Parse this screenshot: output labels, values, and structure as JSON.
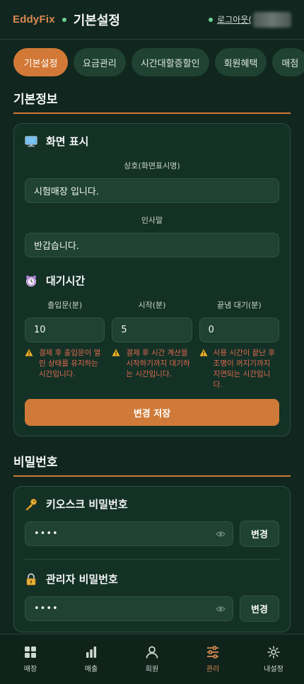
{
  "header": {
    "logo": "EddyFix",
    "title": "기본설정",
    "logout": "로그아웃("
  },
  "tabs": [
    "기본설정",
    "요금관리",
    "시간대할증할인",
    "회원혜택",
    "매점"
  ],
  "basic_info": {
    "section_title": "기본정보",
    "display": {
      "heading": "화면 표시",
      "store_name_label": "상호(화면표시명)",
      "store_name_value": "시험매장 입니다.",
      "greeting_label": "인사말",
      "greeting_value": "반갑습니다."
    },
    "wait": {
      "heading": "대기시간",
      "columns": [
        {
          "label": "출입문(분)",
          "value": "10",
          "warning": "결제 후 출입문이 열린 상태를 유지하는 시간입니다."
        },
        {
          "label": "시작(분)",
          "value": "5",
          "warning": "결제 후 시간 계산을 시작하기까지 대기하는 시간입니다."
        },
        {
          "label": "끝냄 대기(분)",
          "value": "0",
          "warning": "사용 시간이 끝난 후 조명이 꺼지기까지 지연되는 시간입니다."
        }
      ]
    },
    "save_button": "변경 저장"
  },
  "password": {
    "section_title": "비밀번호",
    "kiosk": {
      "heading": "키오스크 비밀번호",
      "value": "••••",
      "button": "변경"
    },
    "admin": {
      "heading": "관리자 비밀번호",
      "value": "••••",
      "button": "변경"
    }
  },
  "nav": [
    {
      "label": "매장",
      "icon": "grid-icon"
    },
    {
      "label": "매출",
      "icon": "bar-chart-icon"
    },
    {
      "label": "회원",
      "icon": "user-icon"
    },
    {
      "label": "관리",
      "icon": "sliders-icon",
      "active": true
    },
    {
      "label": "내설정",
      "icon": "gear-icon"
    }
  ],
  "colors": {
    "accent": "#d27937",
    "background": "#11261e",
    "card": "#143126",
    "warning": "#e06a4f"
  }
}
